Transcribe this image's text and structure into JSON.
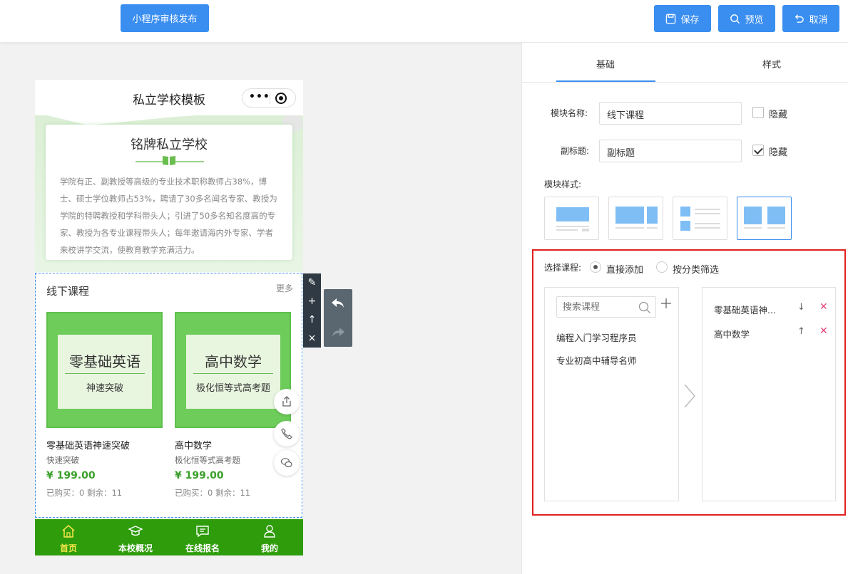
{
  "topbar": {
    "publish_label": "小程序审核发布",
    "save_label": "保存",
    "preview_label": "预览",
    "cancel_label": "取消"
  },
  "phone": {
    "title": "私立学校模板",
    "capsule_dots": "•••",
    "school_name": "铭牌私立学校",
    "intro_text": "学院有正、副教授等高级的专业技术职称教师占38%，博士、硕士学位教师占53%，聘请了30多名闻名专家、教授为学院的特聘教授和学科带头人；引进了50多名知名度高的专家、教授为各专业课程带头人；每年邀请海内外专家、学者来校讲学交流，使教育教学充满活力。",
    "module_title": "线下课程",
    "module_more": "更多",
    "courses": [
      {
        "thumb_title": "零基础英语",
        "thumb_sub": "神速突破",
        "name": "零基础英语神速突破",
        "sub": "快速突破",
        "price": "¥ 199.00",
        "stats": "已购买：0 剩余：11"
      },
      {
        "thumb_title": "高中数学",
        "thumb_sub": "极化恒等式高考题",
        "name": "高中数学",
        "sub": "极化恒等式高考题",
        "price": "¥ 199.00",
        "stats": "已购买：0 剩余：11"
      }
    ],
    "tabbar": [
      {
        "label": "首页",
        "icon": "home-icon"
      },
      {
        "label": "本校概况",
        "icon": "graduation-cap-icon"
      },
      {
        "label": "在线报名",
        "icon": "chat-icon"
      },
      {
        "label": "我的",
        "icon": "user-icon"
      }
    ]
  },
  "panel": {
    "tabs": [
      "基础",
      "样式"
    ],
    "module_name_label": "模块名称:",
    "module_name_value": "线下课程",
    "subtitle_label": "副标题:",
    "subtitle_value": "副标题",
    "hide_label": "隐藏",
    "hide_name_checked": false,
    "hide_subtitle_checked": true,
    "style_label": "模块样式:",
    "selected_style": 4,
    "select_course_label": "选择课程:",
    "radio_direct": "直接添加",
    "radio_category": "按分类筛选",
    "search_placeholder": "搜索课程",
    "available_courses": [
      "编程入门学习程序员",
      "专业初高中辅导名师"
    ],
    "selected_courses": [
      "零基础英语神...",
      "高中数学"
    ]
  },
  "colors": {
    "accent": "#3a8ef0",
    "tabbar": "#2e9c0b",
    "price": "#3aa02a",
    "highlight_border": "#e02020"
  }
}
